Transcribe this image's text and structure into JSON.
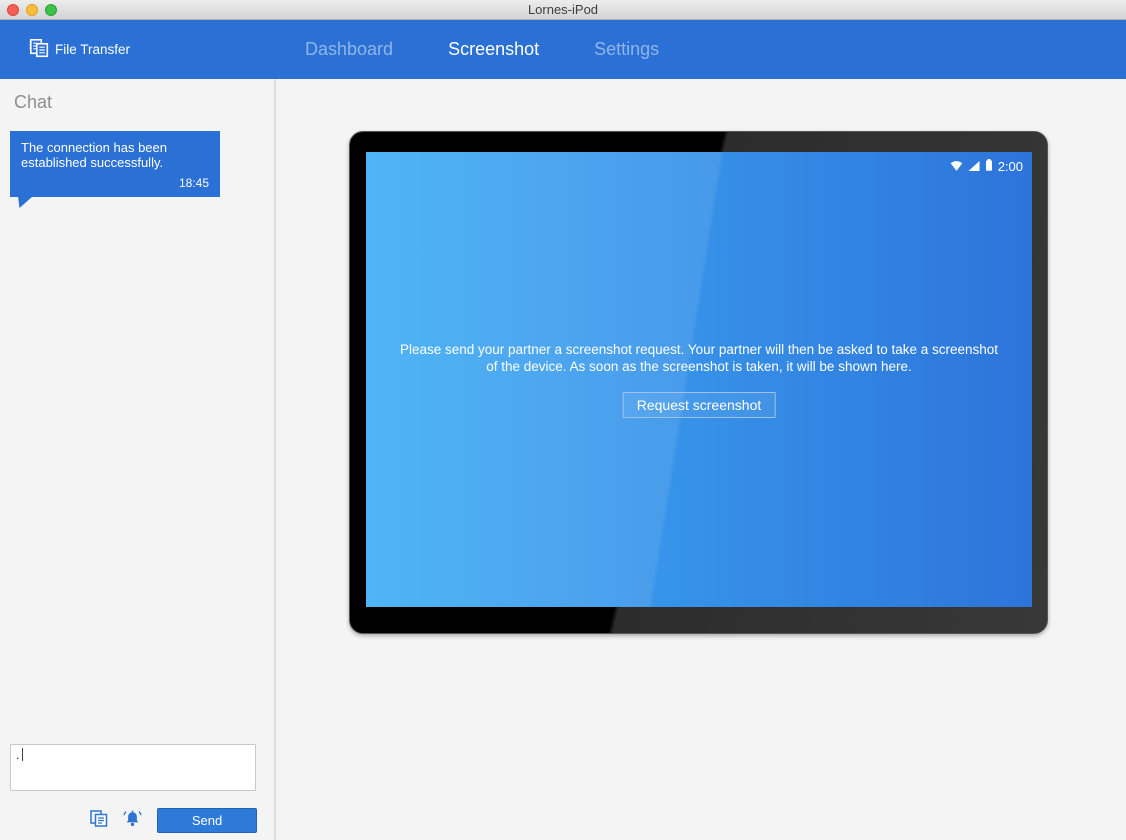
{
  "window": {
    "title": "Lornes-iPod"
  },
  "colors": {
    "header_blue": "#2b70d4",
    "bubble_blue": "#2b70d4",
    "send_button_blue": "#2e7ad8",
    "screen_gradient_left": "#3fadf6",
    "screen_gradient_right": "#2d74da",
    "traffic_red": "#f65f57",
    "traffic_yellow": "#fbbe3c",
    "traffic_green": "#3cc14c"
  },
  "header": {
    "file_transfer": {
      "icon": "file-transfer-icon",
      "label": "File Transfer"
    },
    "tabs": [
      {
        "label": "Dashboard",
        "active": false
      },
      {
        "label": "Screenshot",
        "active": true
      },
      {
        "label": "Settings",
        "active": false
      }
    ]
  },
  "sidebar": {
    "heading": "Chat",
    "messages": [
      {
        "text": "The connection has been established successfully.",
        "time": "18:45"
      }
    ],
    "input": {
      "value": ".",
      "placeholder": ""
    },
    "toolbar": {
      "icons": [
        "copy-icon",
        "bell-icon"
      ],
      "send_label": "Send"
    }
  },
  "main": {
    "device": {
      "statusbar": {
        "icons": [
          "wifi-icon",
          "signal-icon",
          "battery-icon"
        ],
        "time": "2:00"
      },
      "message": "Please send your partner a screenshot request. Your partner will then be asked to take a screenshot of the device. As soon as the screenshot is taken, it will be shown here.",
      "request_button_label": "Request screenshot"
    }
  }
}
